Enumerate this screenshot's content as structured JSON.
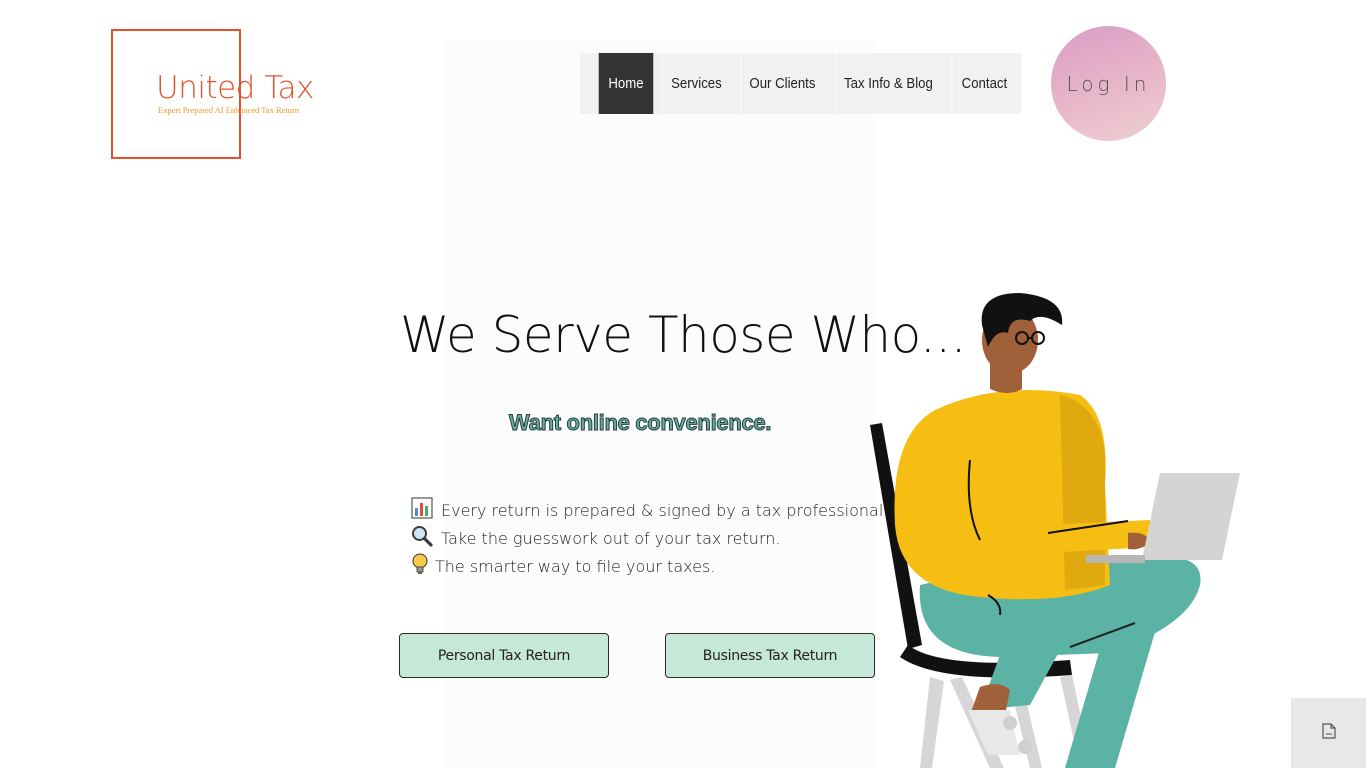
{
  "brand": {
    "name": "United Tax",
    "tagline": "Expert Prepared  AI Enhanced  Tax Return",
    "color": "#e2532d"
  },
  "nav": {
    "items": [
      {
        "label": "Home",
        "active": true
      },
      {
        "label": "Services",
        "active": false
      },
      {
        "label": "Our Clients",
        "active": false
      },
      {
        "label": "Tax Info & Blog",
        "active": false
      },
      {
        "label": "Contact",
        "active": false
      }
    ]
  },
  "login": {
    "label": "Log In"
  },
  "hero": {
    "headline": "We Serve Those Who...",
    "subline": "Want online convenience.",
    "bullets": [
      {
        "icon": "bar-chart-icon",
        "text": "Every return is prepared & signed by a tax professional."
      },
      {
        "icon": "magnifier-icon",
        "text": "Take the guesswork out of your tax return."
      },
      {
        "icon": "lightbulb-icon",
        "text": "The smarter way to file your taxes."
      }
    ]
  },
  "buttons": {
    "personal": "Personal Tax Return",
    "business": "Business Tax Return"
  },
  "colors": {
    "button_bg": "#c5e8d8",
    "subline": "#5bb3a5",
    "nav_active": "#333333"
  }
}
